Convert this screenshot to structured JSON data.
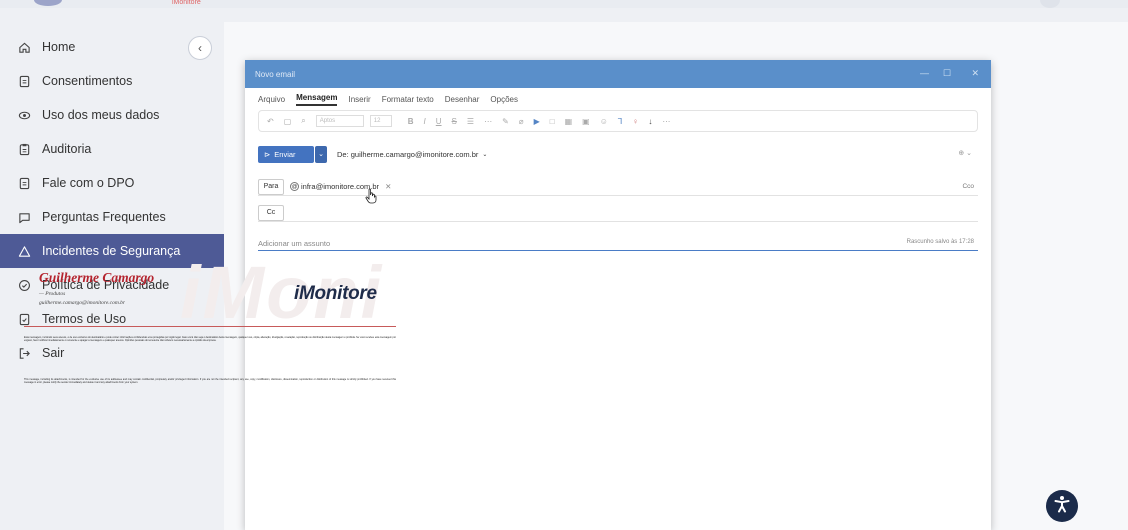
{
  "top": {
    "brand": "iMonitore"
  },
  "sidebar": {
    "items": [
      {
        "label": "Home",
        "icon": "home-icon"
      },
      {
        "label": "Consentimentos",
        "icon": "document-icon"
      },
      {
        "label": "Uso dos meus dados",
        "icon": "eye-icon"
      },
      {
        "label": "Auditoria",
        "icon": "clipboard-icon"
      },
      {
        "label": "Fale com o DPO",
        "icon": "document-icon"
      },
      {
        "label": "Perguntas Frequentes",
        "icon": "chat-icon"
      },
      {
        "label": "Incidentes de Segurança",
        "icon": "warning-icon",
        "active": true
      },
      {
        "label": "Política de Privacidade",
        "icon": "shield-check-icon"
      },
      {
        "label": "Termos de Uso",
        "icon": "document-check-icon"
      },
      {
        "label": "Sair",
        "icon": "logout-icon"
      }
    ],
    "collapse_icon": "chevron-left-icon"
  },
  "email": {
    "window_title": "Novo email",
    "menu": [
      "Arquivo",
      "Mensagem",
      "Inserir",
      "Formatar texto",
      "Desenhar",
      "Opções"
    ],
    "active_menu": "Mensagem",
    "font_name": "Aptos",
    "font_size": "12",
    "send_label": "Enviar",
    "from": "De: guilherme.camargo@imonitore.com.br",
    "to_label": "Para",
    "recipient": "infra@imonitore.com.br",
    "cc_label": "Cc",
    "bcc_label": "Cco",
    "subject_placeholder": "Adicionar um assunto",
    "draft_status": "Rascunho salvo às 17:28"
  },
  "signature": {
    "name": "Guilherme Camargo",
    "role": "— Produtos",
    "email": "guilherme.camargo@imonitore.com.br",
    "brand": "iMonitore",
    "watermark": "iMoni",
    "disclaimer_pt": "Esta mensagem, incluindo seus anexos, é de uso exclusivo do destinatário e pode conter informações confidenciais e/ou protegidas por sigilo legal. Caso você não seja o destinatário desta mensagem, qualquer uso, cópia, alteração, divulgação, revelação, reprodução ou distribuição desta mensagem é proibida. Se você recebeu esta mensagem por engano, favor notificar imediatamente o remetente e apagar a mensagem e quaisquer anexos. Opiniões pessoais do remetente não refletem necessariamente a opinião da empresa.",
    "disclaimer_en": "This message, including its attachments, is intended for the exclusive use of its addressee and may contain confidential, proprietary and/or privileged information. If you are not the intended recipient, any use, copy, modification, disclosure, dissemination, reproduction or distribution of this message is strictly prohibited. If you have received this message in error, please notify the sender immediately and delete it and any attachments from your system."
  },
  "accessibility": {
    "icon": "accessibility-icon"
  }
}
